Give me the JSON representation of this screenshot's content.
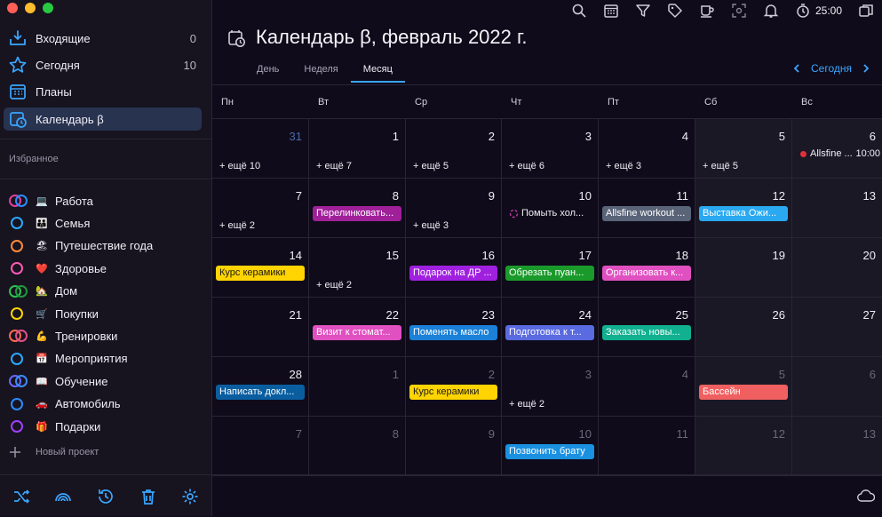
{
  "window": {
    "traffic": [
      "#ff5f57",
      "#febc2e",
      "#28c840"
    ]
  },
  "sidebar": {
    "nav": [
      {
        "label": "Входящие",
        "count": "0",
        "icon": "inbox-icon"
      },
      {
        "label": "Сегодня",
        "count": "10",
        "icon": "star-icon"
      },
      {
        "label": "Планы",
        "count": "",
        "icon": "calendar-grid-icon"
      },
      {
        "label": "Календарь β",
        "count": "",
        "icon": "calendar-clock-icon",
        "active": true
      }
    ],
    "favorites_title": "Избранное",
    "projects": [
      {
        "label": "Работа",
        "emoji": "💻",
        "colors": [
          "#e040a0",
          "#2a8cff"
        ]
      },
      {
        "label": "Семья",
        "emoji": "👪",
        "colors": [
          "#2aa8ff"
        ]
      },
      {
        "label": "Путешествие года",
        "emoji": "🏖",
        "colors": [
          "#ff8a3a"
        ]
      },
      {
        "label": "Здоровье",
        "emoji": "❤️",
        "colors": [
          "#ff5ab4"
        ]
      },
      {
        "label": "Дом",
        "emoji": "🏡",
        "colors": [
          "#2ec050",
          "#1e9a3c"
        ]
      },
      {
        "label": "Покупки",
        "emoji": "🛒",
        "colors": [
          "#ffd400"
        ]
      },
      {
        "label": "Тренировки",
        "emoji": "💪",
        "colors": [
          "#ff6a50",
          "#e0508a"
        ]
      },
      {
        "label": "Мероприятия",
        "emoji": "📅",
        "colors": [
          "#2aa8ff"
        ]
      },
      {
        "label": "Обучение",
        "emoji": "📖",
        "colors": [
          "#6a6aff",
          "#3a8cff"
        ]
      },
      {
        "label": "Автомобиль",
        "emoji": "🚗",
        "colors": [
          "#2a8cff"
        ]
      },
      {
        "label": "Подарки",
        "emoji": "🎁",
        "colors": [
          "#a040ff"
        ]
      }
    ],
    "new_project": "Новый проект"
  },
  "toolbar": {
    "timer": "25:00"
  },
  "header": {
    "title": "Календарь β, февраль 2022 г.",
    "tabs": [
      {
        "label": "День"
      },
      {
        "label": "Неделя"
      },
      {
        "label": "Месяц",
        "active": true
      }
    ],
    "today": "Сегодня"
  },
  "calendar": {
    "weekdays": [
      "Пн",
      "Вт",
      "Ср",
      "Чт",
      "Пт",
      "Сб",
      "Вс"
    ],
    "weeks": [
      [
        {
          "day": "31",
          "other": true,
          "first": true,
          "more": "+ ещё 10"
        },
        {
          "day": "1",
          "more": "+ ещё 7"
        },
        {
          "day": "2",
          "more": "+ ещё 5"
        },
        {
          "day": "3",
          "more": "+ ещё 6"
        },
        {
          "day": "4",
          "more": "+ ещё 3"
        },
        {
          "day": "5",
          "more": "+ ещё 5"
        },
        {
          "day": "6",
          "event": {
            "title": "Allsfine ...",
            "time": "10:00",
            "style": "dot"
          }
        }
      ],
      [
        {
          "day": "7",
          "more": "+ ещё 2"
        },
        {
          "day": "8",
          "event": {
            "title": "Перелинковать...",
            "color": "#a0209a"
          }
        },
        {
          "day": "9",
          "more": "+ ещё 3"
        },
        {
          "day": "10",
          "event": {
            "title": "Помыть хол...",
            "style": "plain"
          }
        },
        {
          "day": "11",
          "event": {
            "title": "Allsfine workout ...",
            "color": "#5a6478"
          }
        },
        {
          "day": "12",
          "event": {
            "title": "Выставка Ожи...",
            "color": "#2aa8f0"
          }
        },
        {
          "day": "13"
        }
      ],
      [
        {
          "day": "14",
          "event": {
            "title": "Курс керамики",
            "color": "#ffd400",
            "dark": true
          }
        },
        {
          "day": "15",
          "more": "+ ещё 2"
        },
        {
          "day": "16",
          "event": {
            "title": "Подарок на ДР ...",
            "color": "#a020e0"
          }
        },
        {
          "day": "17",
          "event": {
            "title": "Обрезать пуан...",
            "color": "#1a9a2a"
          }
        },
        {
          "day": "18",
          "event": {
            "title": "Организовать к...",
            "color": "#e050c0"
          }
        },
        {
          "day": "19"
        },
        {
          "day": "20"
        }
      ],
      [
        {
          "day": "21"
        },
        {
          "day": "22",
          "event": {
            "title": "Визит к стомат...",
            "color": "#e050c0"
          }
        },
        {
          "day": "23",
          "event": {
            "title": "Поменять масло",
            "color": "#1a80d8"
          }
        },
        {
          "day": "24",
          "event": {
            "title": "Подготовка к т...",
            "color": "#5a6ae0"
          }
        },
        {
          "day": "25",
          "event": {
            "title": "Заказать новы...",
            "color": "#10b090"
          }
        },
        {
          "day": "26"
        },
        {
          "day": "27"
        }
      ],
      [
        {
          "day": "28",
          "event": {
            "title": "Написать докл...",
            "color": "#0a5ea0"
          }
        },
        {
          "day": "1",
          "other": true
        },
        {
          "day": "2",
          "other": true,
          "event": {
            "title": "Курс керамики",
            "color": "#ffd400",
            "dark": true
          }
        },
        {
          "day": "3",
          "other": true,
          "more": "+ ещё 2"
        },
        {
          "day": "4",
          "other": true
        },
        {
          "day": "5",
          "other": true,
          "event": {
            "title": "Бассейн",
            "color": "#f06060"
          }
        },
        {
          "day": "6",
          "other": true
        }
      ],
      [
        {
          "day": "7",
          "other": true
        },
        {
          "day": "8",
          "other": true
        },
        {
          "day": "9",
          "other": true
        },
        {
          "day": "10",
          "other": true,
          "event": {
            "title": "Позвонить брату",
            "color": "#1a90e0"
          }
        },
        {
          "day": "11",
          "other": true
        },
        {
          "day": "12",
          "other": true
        },
        {
          "day": "13",
          "other": true
        }
      ]
    ]
  }
}
